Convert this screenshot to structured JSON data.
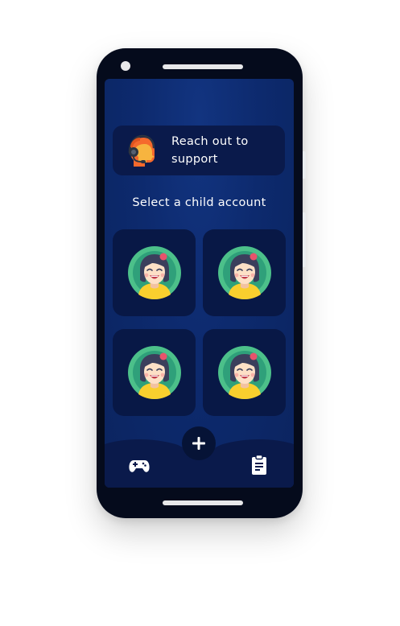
{
  "support": {
    "label": "Reach out to support",
    "icon": "headset-support-icon"
  },
  "main": {
    "title": "Select a child account",
    "children": [
      {
        "avatar": "girl-avatar-icon"
      },
      {
        "avatar": "girl-avatar-icon"
      },
      {
        "avatar": "girl-avatar-icon"
      },
      {
        "avatar": "girl-avatar-icon"
      }
    ]
  },
  "bottom_nav": {
    "add_icon": "plus-icon",
    "left_icon": "gamepad-icon",
    "right_icon": "clipboard-icon"
  },
  "colors": {
    "screen_bg": "#0d2a6e",
    "card_bg": "#081846",
    "text": "#ffffff",
    "avatar_ring": "#4cc08a",
    "accent_orange": "#f5692d"
  }
}
